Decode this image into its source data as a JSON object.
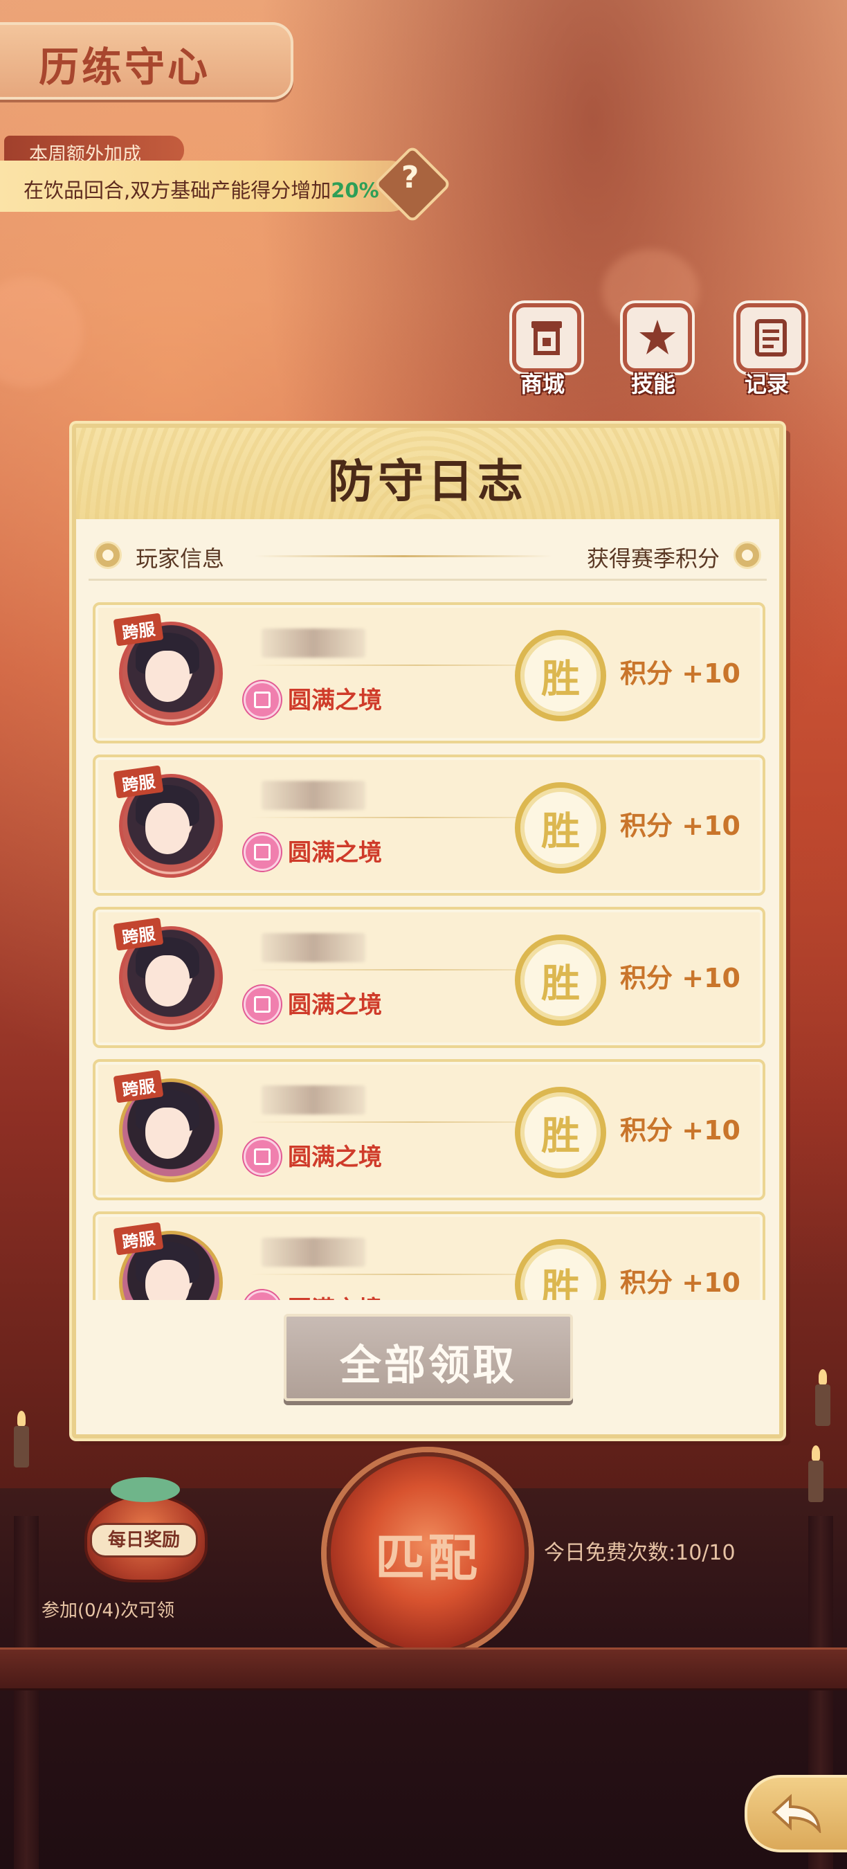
{
  "header": {
    "title": "历练守心",
    "bonus_tag": "本周额外加成",
    "bonus_text": "在饮品回合,双方基础产能得分增加",
    "bonus_value": "20%",
    "help_label": "?"
  },
  "top_buttons": [
    {
      "label": "商城",
      "icon": "shop-icon"
    },
    {
      "label": "技能",
      "icon": "skill-icon"
    },
    {
      "label": "记录",
      "icon": "record-icon"
    }
  ],
  "dialog": {
    "title": "防守日志",
    "col_left": "玩家信息",
    "col_right": "获得赛季积分",
    "entries": [
      {
        "badge": "跨服",
        "realm": "圆满之境",
        "result": "胜",
        "score": "积分 +10"
      },
      {
        "badge": "跨服",
        "realm": "圆满之境",
        "result": "胜",
        "score": "积分 +10"
      },
      {
        "badge": "跨服",
        "realm": "圆满之境",
        "result": "胜",
        "score": "积分 +10"
      },
      {
        "badge": "跨服",
        "realm": "圆满之境",
        "result": "胜",
        "score": "积分 +10"
      },
      {
        "badge": "跨服",
        "realm": "圆满之境",
        "result": "胜",
        "score": "积分 +10"
      }
    ],
    "claim_all": "全部领取"
  },
  "bottom": {
    "daily_reward": "每日奖励",
    "daily_caption": "参加(0/4)次可领",
    "match_label": "匹配",
    "free_count": "今日免费次数:10/10"
  },
  "colors": {
    "accent_red": "#cf3b2a",
    "gold": "#dcb750",
    "score_orange": "#c9752b",
    "bonus_green": "#2e9f57"
  }
}
